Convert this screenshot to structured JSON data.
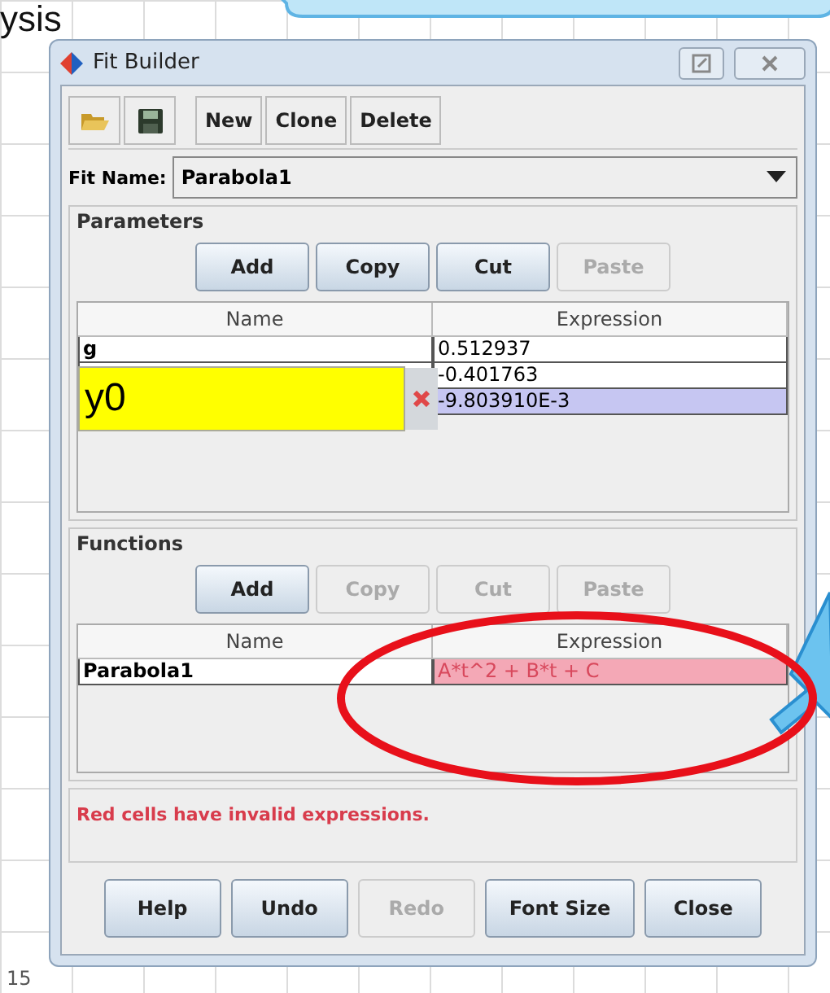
{
  "slide_title": "ysis",
  "axis_label": "15",
  "window": {
    "title": "Fit Builder"
  },
  "toolbar": {
    "buttons": [
      {
        "label": "New"
      },
      {
        "label": "Clone"
      },
      {
        "label": "Delete"
      }
    ]
  },
  "fit_name": {
    "label": "Fit Name:",
    "value": "Parabola1"
  },
  "parameters": {
    "title": "Parameters",
    "buttons": [
      {
        "label": "Add",
        "disabled": false
      },
      {
        "label": "Copy",
        "disabled": false
      },
      {
        "label": "Cut",
        "disabled": false
      },
      {
        "label": "Paste",
        "disabled": true
      }
    ],
    "columns": [
      "Name",
      "Expression"
    ],
    "rows": [
      {
        "name": "g",
        "expression": "0.512937",
        "selected": false,
        "invalid": false
      },
      {
        "expression": "-0.401763",
        "selected": false,
        "invalid": false
      },
      {
        "expression": "-9.803910E-3",
        "selected": true,
        "invalid": false,
        "editor": {
          "value": "y0",
          "invalid": true
        }
      }
    ]
  },
  "functions": {
    "title": "Functions",
    "buttons": [
      {
        "label": "Add",
        "disabled": false
      },
      {
        "label": "Copy",
        "disabled": true
      },
      {
        "label": "Cut",
        "disabled": true
      },
      {
        "label": "Paste",
        "disabled": true
      }
    ],
    "columns": [
      "Name",
      "Expression"
    ],
    "rows": [
      {
        "name": "Parabola1",
        "expression": "A*t^2 + B*t + C",
        "selected": false,
        "invalid": true
      }
    ]
  },
  "message": "Red cells have invalid expressions.",
  "footer_buttons": [
    {
      "label": "Help",
      "disabled": false
    },
    {
      "label": "Undo",
      "disabled": false
    },
    {
      "label": "Redo",
      "disabled": true
    },
    {
      "label": "Font Size",
      "disabled": false
    },
    {
      "label": "Close",
      "disabled": false
    }
  ]
}
